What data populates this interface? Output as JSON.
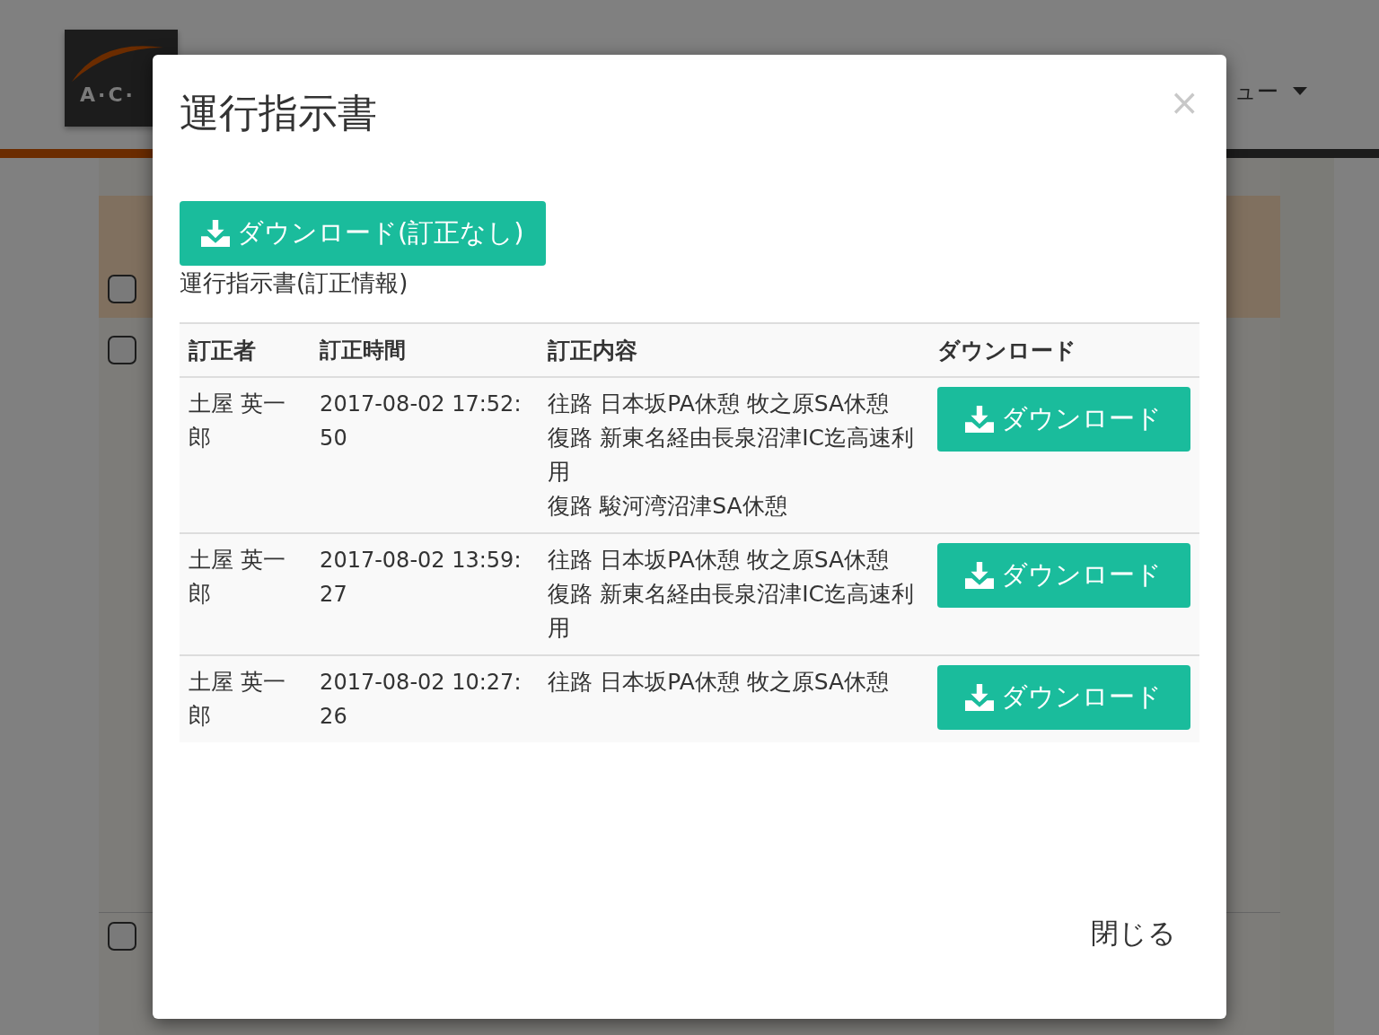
{
  "background": {
    "logo": "A·C·",
    "menu": "ュー",
    "checkboxes": [
      {
        "checked": false
      },
      {
        "checked": false
      },
      {
        "checked": false
      }
    ]
  },
  "modal": {
    "title": "運行指示書",
    "download_button": "ダウンロード(訂正なし)",
    "section_label": "運行指示書(訂正情報)",
    "table": {
      "columns": [
        "訂正者",
        "訂正時間",
        "訂正内容",
        "ダウンロード"
      ],
      "rows": [
        {
          "person": "土屋 英一郎",
          "time": "2017-08-02 17:52:50",
          "details": [
            "往路 日本坂PA休憩 牧之原SA休憩",
            "復路 新東名経由長泉沼津IC迄高速利用",
            "復路 駿河湾沼津SA休憩"
          ],
          "button": "ダウンロード"
        },
        {
          "person": "土屋 英一郎",
          "time": "2017-08-02 13:59:27",
          "details": [
            "往路 日本坂PA休憩 牧之原SA休憩",
            "復路 新東名経由長泉沼津IC迄高速利用"
          ],
          "button": "ダウンロード"
        },
        {
          "person": "土屋 英一郎",
          "time": "2017-08-02 10:27:26",
          "details": [
            "往路 日本坂PA休憩 牧之原SA休憩"
          ],
          "button": "ダウンロード"
        }
      ]
    },
    "close_icon": "×",
    "close_button": "閉じる"
  }
}
